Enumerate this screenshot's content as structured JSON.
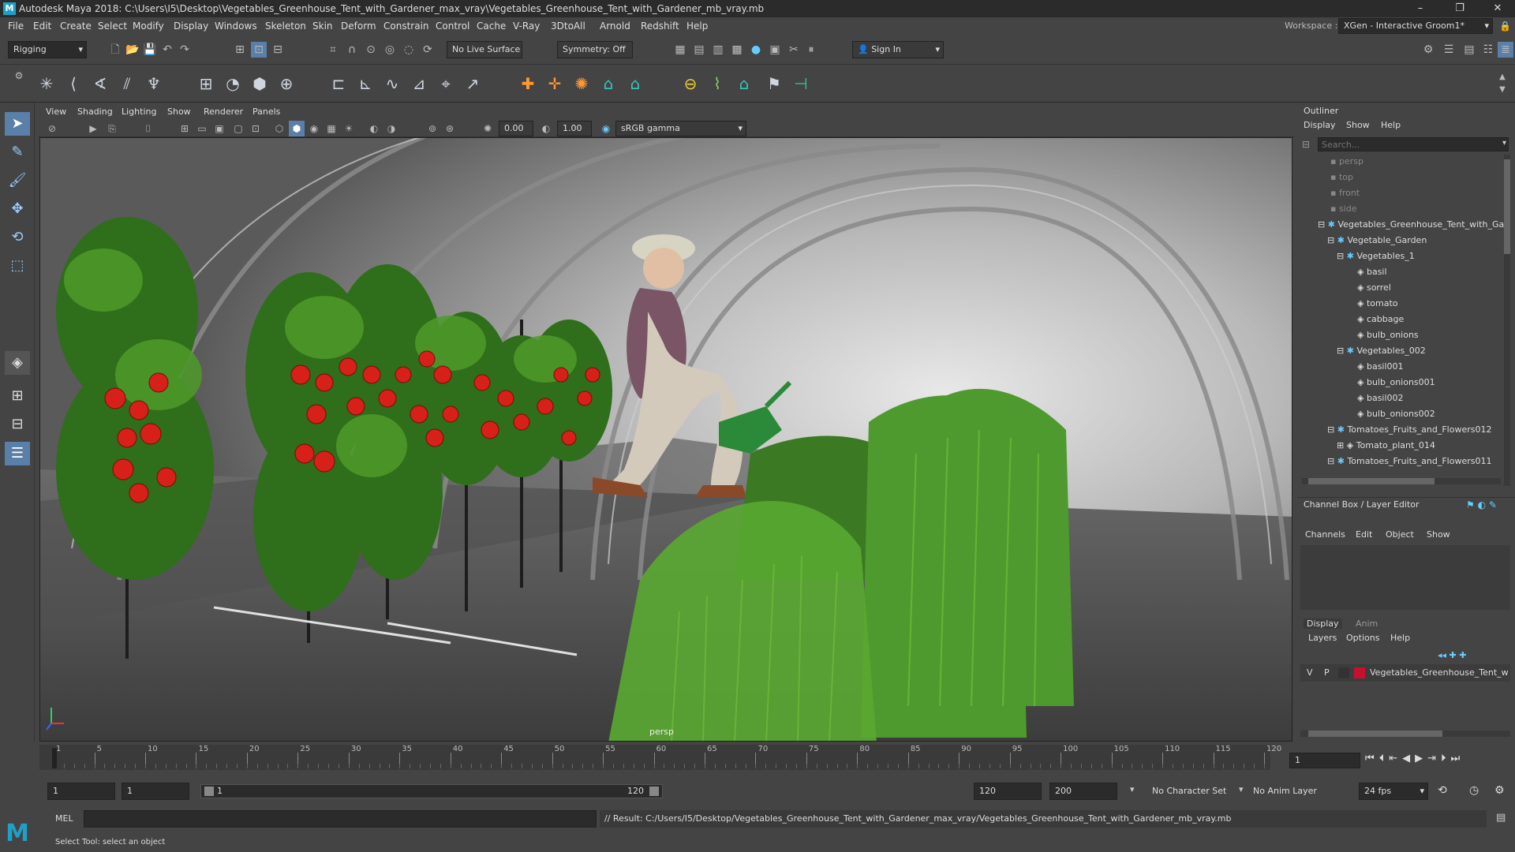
{
  "window": {
    "title": "Autodesk Maya 2018: C:\\Users\\I5\\Desktop\\Vegetables_Greenhouse_Tent_with_Gardener_max_vray\\Vegetables_Greenhouse_Tent_with_Gardener_mb_vray.mb"
  },
  "menus": [
    "File",
    "Edit",
    "Create",
    "Select",
    "Modify",
    "Display",
    "Windows",
    "Skeleton",
    "Skin",
    "Deform",
    "Constrain",
    "Control",
    "Cache",
    "V-Ray",
    "3DtoAll",
    "Arnold",
    "Redshift",
    "Help"
  ],
  "workspace": {
    "label": "Workspace :",
    "value": "XGen - Interactive Groom1*"
  },
  "shelf": {
    "menuset": "Rigging",
    "live_surface": "No Live Surface",
    "symmetry": "Symmetry: Off",
    "signin": "Sign In"
  },
  "viewport_menu": [
    "View",
    "Shading",
    "Lighting",
    "Show",
    "Renderer",
    "Panels"
  ],
  "viewport_toolbar": {
    "exposure": "0.00",
    "gamma": "1.00",
    "colorspace": "sRGB gamma"
  },
  "viewport": {
    "camera": "persp"
  },
  "outliner": {
    "title": "Outliner",
    "menu": [
      "Display",
      "Show",
      "Help"
    ],
    "search_placeholder": "Search...",
    "items": [
      "persp",
      "top",
      "front",
      "side",
      "Vegetables_Greenhouse_Tent_with_Gar",
      "Vegetable_Garden",
      "Vegetables_1",
      "basil",
      "sorrel",
      "tomato",
      "cabbage",
      "bulb_onions",
      "Vegetables_002",
      "basil001",
      "bulb_onions001",
      "basil002",
      "bulb_onions002",
      "Tomatoes_Fruits_and_Flowers012",
      "Tomato_plant_014",
      "Tomatoes_Fruits_and_Flowers011"
    ]
  },
  "channelbox": {
    "title": "Channel Box / Layer Editor",
    "menu": [
      "Channels",
      "Edit",
      "Object",
      "Show"
    ]
  },
  "layers": {
    "tabs": [
      "Display",
      "Anim"
    ],
    "menu": [
      "Layers",
      "Options",
      "Help"
    ],
    "v": "V",
    "p": "P",
    "layer_name": "Vegetables_Greenhouse_Tent_w",
    "layer_color": "#c8102e"
  },
  "timeline": {
    "ticks": [
      "1",
      "5",
      "10",
      "15",
      "20",
      "25",
      "30",
      "35",
      "40",
      "45",
      "50",
      "55",
      "60",
      "65",
      "70",
      "75",
      "80",
      "85",
      "90",
      "95",
      "100",
      "105",
      "110",
      "115",
      "120"
    ],
    "current": "1"
  },
  "range": {
    "start": "1",
    "playstart": "1",
    "slider_start": "1",
    "slider_end": "120",
    "playend": "120",
    "end": "200",
    "charset": "No Character Set",
    "animlayer": "No Anim Layer",
    "fps": "24 fps"
  },
  "cmdline": {
    "lang": "MEL",
    "result": "// Result: C:/Users/I5/Desktop/Vegetables_Greenhouse_Tent_with_Gardener_max_vray/Vegetables_Greenhouse_Tent_with_Gardener_mb_vray.mb"
  },
  "helpline": "Select Tool: select an object"
}
